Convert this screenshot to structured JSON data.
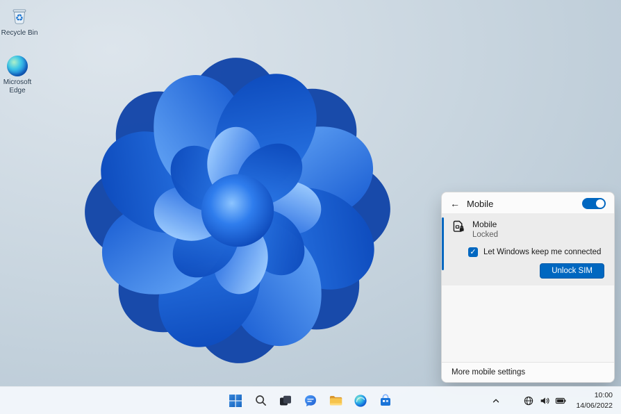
{
  "colors": {
    "accent": "#0067c0",
    "taskbar_bg": "#f3f7fb",
    "flyout_bg": "#fbfbfb",
    "card_bg": "#ececec",
    "wallpaper_bloom_blue": "#1256cf"
  },
  "icons": {
    "back_arrow": "←",
    "check": "✓"
  },
  "desktop": {
    "icons": [
      {
        "name": "recycle-bin",
        "label": "Recycle Bin"
      },
      {
        "name": "microsoft-edge",
        "label": "Microsoft Edge"
      }
    ]
  },
  "flyout": {
    "title": "Mobile",
    "toggle_state": "on",
    "card": {
      "title": "Mobile",
      "status": "Locked",
      "checkbox_label": "Let Windows keep me connected",
      "checkbox_checked": true,
      "unlock_button": "Unlock SIM"
    },
    "footer_link": "More mobile settings"
  },
  "taskbar": {
    "buttons": [
      "start",
      "search",
      "task-view",
      "chat",
      "file-explorer",
      "edge",
      "store"
    ],
    "tray_icons": [
      "network-globe",
      "speaker",
      "battery"
    ],
    "clock": {
      "time": "10:00",
      "date": "14/06/2022"
    }
  }
}
